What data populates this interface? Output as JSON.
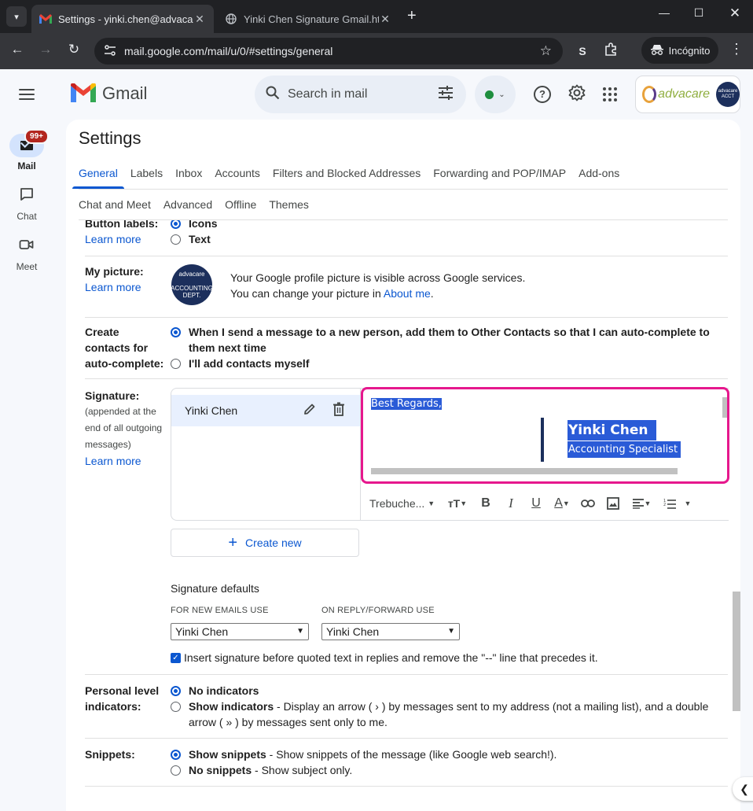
{
  "browser": {
    "tabs": [
      {
        "title": "Settings - yinki.chen@advacarep",
        "active": true,
        "favicon": "gmail-icon"
      },
      {
        "title": "Yinki Chen Signature Gmail.htm",
        "active": false,
        "favicon": "globe-icon"
      }
    ],
    "url": "mail.google.com/mail/u/0/#settings/general",
    "profile_letter": "S",
    "incognito_label": "Incógnito"
  },
  "gmail": {
    "app_name": "Gmail",
    "search_placeholder": "Search in mail",
    "status_color": "#1e8e3e"
  },
  "rail": {
    "mail_label": "Mail",
    "mail_badge": "99+",
    "chat_label": "Chat",
    "meet_label": "Meet"
  },
  "settings": {
    "title": "Settings",
    "tabs_row1": [
      "General",
      "Labels",
      "Inbox",
      "Accounts",
      "Filters and Blocked Addresses",
      "Forwarding and POP/IMAP",
      "Add-ons"
    ],
    "tabs_row2": [
      "Chat and Meet",
      "Advanced",
      "Offline",
      "Themes"
    ],
    "button_labels": {
      "label": "Button labels:",
      "learn_more": "Learn more",
      "opt_icons": "Icons",
      "opt_text": "Text"
    },
    "my_picture": {
      "label": "My picture:",
      "learn_more": "Learn more",
      "line1": "Your Google profile picture is visible across Google services.",
      "line2_prefix": "You can change your picture in ",
      "line2_link": "About me",
      "line2_suffix": "."
    },
    "contacts": {
      "label_1": "Create",
      "label_2": "contacts for",
      "label_3": "auto-complete:",
      "opt_auto": "When I send a message to a new person, add them to Other Contacts so that I can auto-complete to them next time",
      "opt_manual": "I'll add contacts myself"
    },
    "signature": {
      "label": "Signature:",
      "sub_1": "(appended at the",
      "sub_2": "end of all outgoing",
      "sub_3": "messages)",
      "learn_more": "Learn more",
      "item_name": "Yinki Chen",
      "greeting": "Best Regards,",
      "sig_name": "Yinki Chen",
      "sig_role": "Accounting Specialist",
      "font_name": "Trebuche...",
      "create_new": "Create new",
      "defaults_title": "Signature defaults",
      "new_emails_caption": "FOR NEW EMAILS USE",
      "reply_caption": "ON REPLY/FORWARD USE",
      "new_emails_value": "Yinki Chen",
      "reply_value": "Yinki Chen",
      "insert_before": "Insert signature before quoted text in replies and remove the \"--\" line that precedes it."
    },
    "indicators": {
      "label_1": "Personal level",
      "label_2": "indicators:",
      "opt_none": "No indicators",
      "opt_show": "Show indicators",
      "opt_show_desc": " - Display an arrow ( › ) by messages sent to my address (not a mailing list), and a double arrow ( » ) by messages sent only to me."
    },
    "snippets": {
      "label": "Snippets:",
      "opt_show": "Show snippets",
      "opt_show_desc": " - Show snippets of the message (like Google web search!).",
      "opt_none": "No snippets",
      "opt_none_desc": " - Show subject only."
    }
  }
}
